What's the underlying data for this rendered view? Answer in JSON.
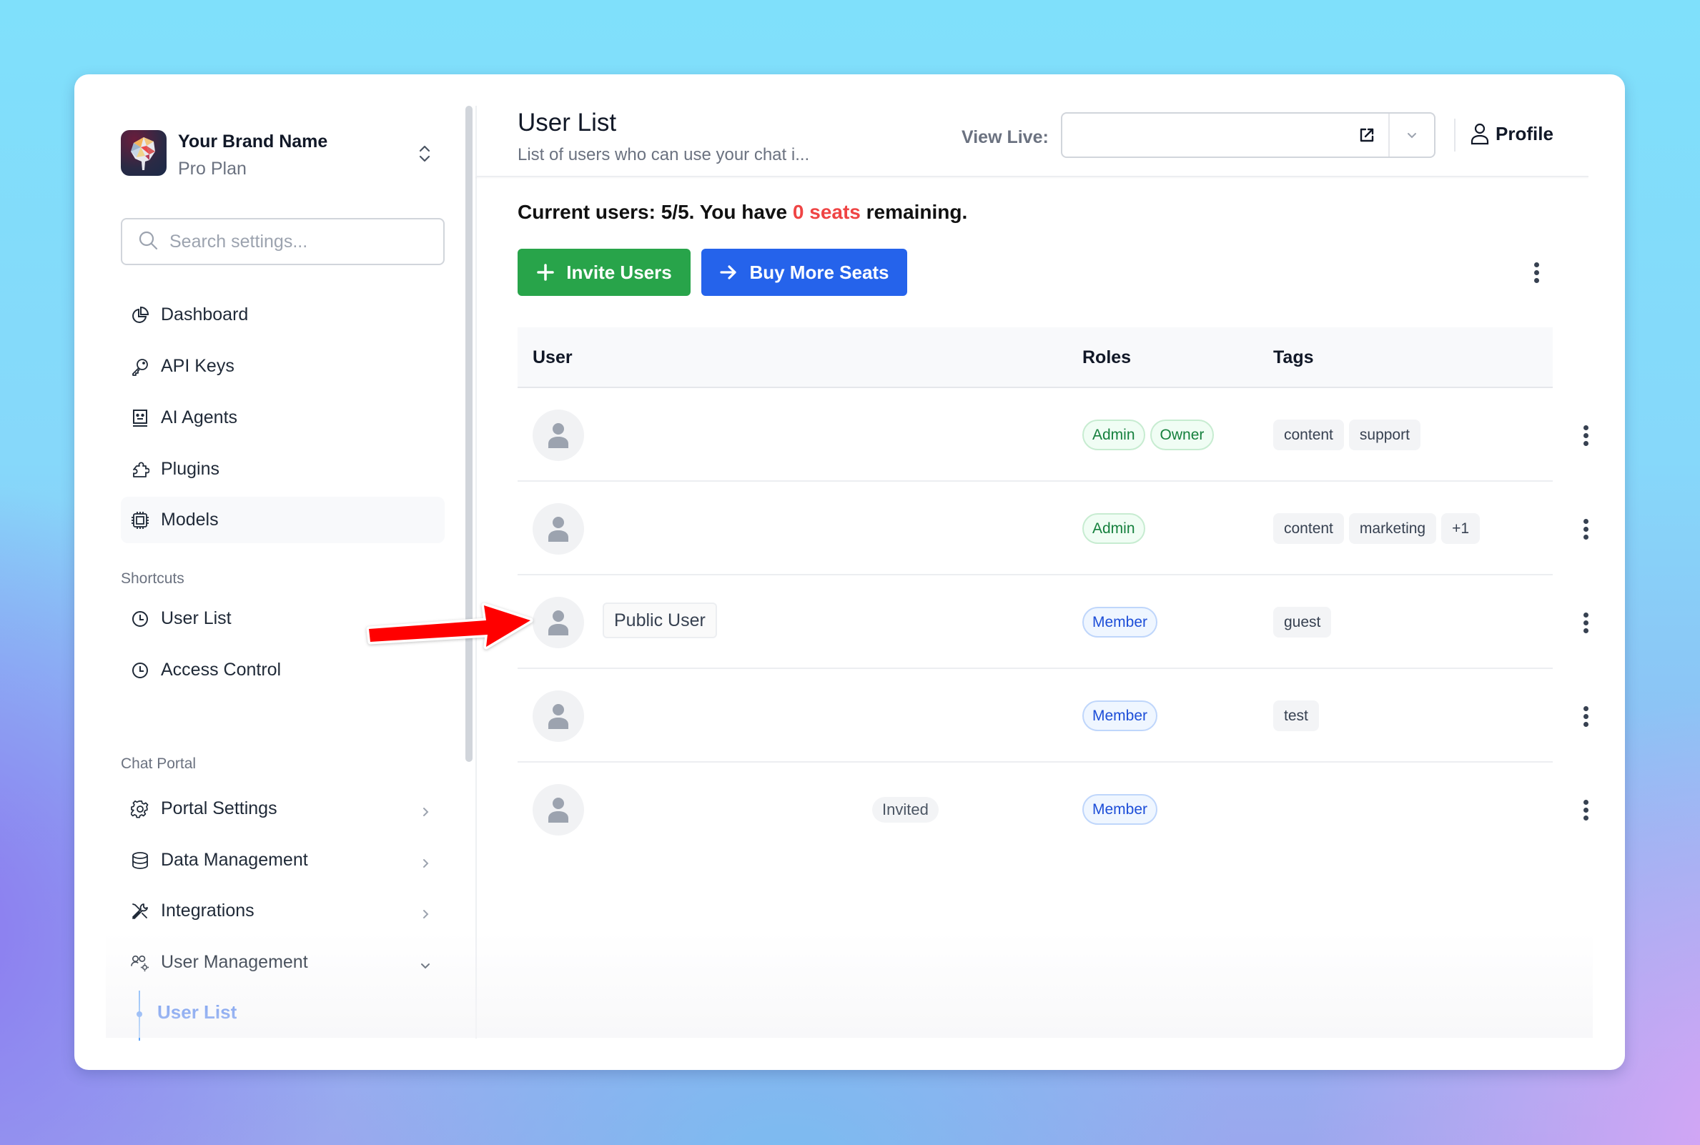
{
  "sidebar": {
    "brand": {
      "name": "Your Brand Name",
      "plan": "Pro Plan"
    },
    "search_placeholder": "Search settings...",
    "nav": [
      {
        "label": "Dashboard",
        "icon": "pie-chart-icon"
      },
      {
        "label": "API Keys",
        "icon": "key-icon"
      },
      {
        "label": "AI Agents",
        "icon": "robot-face-icon"
      },
      {
        "label": "Plugins",
        "icon": "puzzle-icon"
      },
      {
        "label": "Models",
        "icon": "cpu-chip-icon",
        "highlighted": true
      }
    ],
    "shortcuts_label": "Shortcuts",
    "shortcuts": [
      {
        "label": "User List",
        "icon": "clock-icon"
      },
      {
        "label": "Access Control",
        "icon": "clock-icon"
      }
    ],
    "chat_portal_label": "Chat Portal",
    "chat_portal": [
      {
        "label": "Portal Settings",
        "icon": "gear-icon",
        "expanded": false
      },
      {
        "label": "Data Management",
        "icon": "database-icon",
        "expanded": false
      },
      {
        "label": "Integrations",
        "icon": "tools-icon",
        "expanded": false
      },
      {
        "label": "User Management",
        "icon": "users-gear-icon",
        "expanded": true
      }
    ],
    "sub_items": [
      {
        "label": "User List",
        "active": true
      }
    ]
  },
  "header": {
    "title": "User List",
    "subtitle": "List of users who can use your chat i...",
    "view_live_label": "View Live:",
    "view_live_value": "",
    "profile_label": "Profile"
  },
  "seats": {
    "prefix": "Current users: 5/5. You have ",
    "highlight": "0 seats",
    "suffix": " remaining.",
    "current": 5,
    "total": 5,
    "remaining": 0
  },
  "actions": {
    "invite_label": "Invite Users",
    "buy_label": "Buy More Seats"
  },
  "colors": {
    "invite_green": "#28a44a",
    "buy_blue": "#2563eb",
    "seats_red": "#ef4444",
    "annotation_arrow": "#ff0000"
  },
  "table": {
    "columns": [
      "User",
      "Roles",
      "Tags"
    ],
    "rows": [
      {
        "name": "",
        "status": "",
        "roles": [
          "Admin",
          "Owner"
        ],
        "role_color": "green",
        "tags": [
          "content",
          "support"
        ]
      },
      {
        "name": "",
        "status": "",
        "roles": [
          "Admin"
        ],
        "role_color": "green",
        "tags": [
          "content",
          "marketing",
          "+1"
        ]
      },
      {
        "name": "Public User",
        "status": "",
        "roles": [
          "Member"
        ],
        "role_color": "blue",
        "tags": [
          "guest"
        ]
      },
      {
        "name": "",
        "status": "",
        "roles": [
          "Member"
        ],
        "role_color": "blue",
        "tags": [
          "test"
        ]
      },
      {
        "name": "",
        "status": "Invited",
        "roles": [
          "Member"
        ],
        "role_color": "blue",
        "tags": []
      }
    ]
  },
  "annotation": {
    "type": "arrow",
    "points_to": "Public User avatar"
  }
}
